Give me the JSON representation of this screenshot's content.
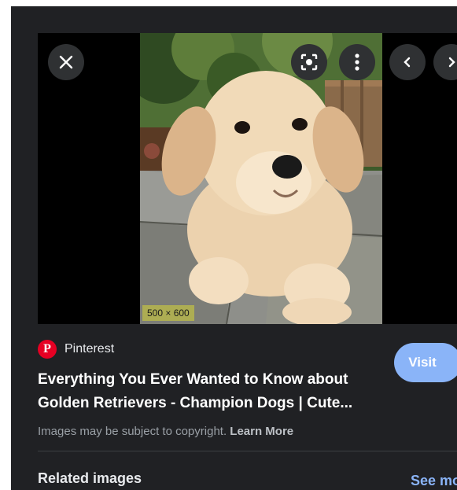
{
  "viewer": {
    "close_icon": "close-icon",
    "lens_icon": "lens-icon",
    "more_icon": "more-vert-icon",
    "prev_icon": "chevron-left-icon",
    "next_icon": "chevron-right-icon",
    "dimensions": "500 × 600"
  },
  "source": {
    "logo_letter": "P",
    "name": "Pinterest",
    "brand_color": "#e60023"
  },
  "result": {
    "title_line1": "Everything You Ever Wanted to Know about",
    "title_line2": "Golden Retrievers - Champion Dogs | Cute...",
    "visit_label": "Visit"
  },
  "copyright": {
    "text": "Images may be subject to copyright.",
    "learn_more": "Learn More"
  },
  "related": {
    "heading": "Related images",
    "see_more": "See more"
  },
  "colors": {
    "panel_bg": "#202124",
    "accent_blue": "#8ab4f8"
  }
}
